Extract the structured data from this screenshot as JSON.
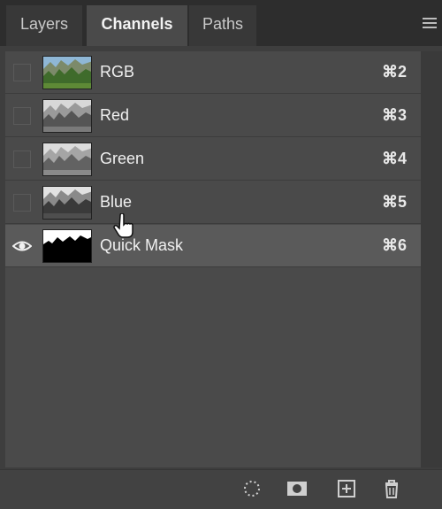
{
  "tabs": [
    {
      "label": "Layers",
      "active": false
    },
    {
      "label": "Channels",
      "active": true
    },
    {
      "label": "Paths",
      "active": false
    }
  ],
  "channels": [
    {
      "name": "RGB",
      "shortcut": "⌘2",
      "visible": false,
      "selected": false,
      "thumbnail": "color-forest"
    },
    {
      "name": "Red",
      "shortcut": "⌘3",
      "visible": false,
      "selected": false,
      "thumbnail": "grayscale-forest"
    },
    {
      "name": "Green",
      "shortcut": "⌘4",
      "visible": false,
      "selected": false,
      "thumbnail": "grayscale-forest"
    },
    {
      "name": "Blue",
      "shortcut": "⌘5",
      "visible": false,
      "selected": false,
      "thumbnail": "grayscale-dark-forest"
    },
    {
      "name": "Quick Mask",
      "shortcut": "⌘6",
      "visible": true,
      "selected": true,
      "thumbnail": "mask-silhouette"
    }
  ],
  "toolbar_icons": [
    "load-selection-icon",
    "save-selection-icon",
    "new-channel-icon",
    "delete-channel-icon"
  ],
  "colors": {
    "panel_bg": "#4a4a4a",
    "selected_row": "#5a5a5a",
    "tabbar_bg": "#2d2d2d"
  }
}
